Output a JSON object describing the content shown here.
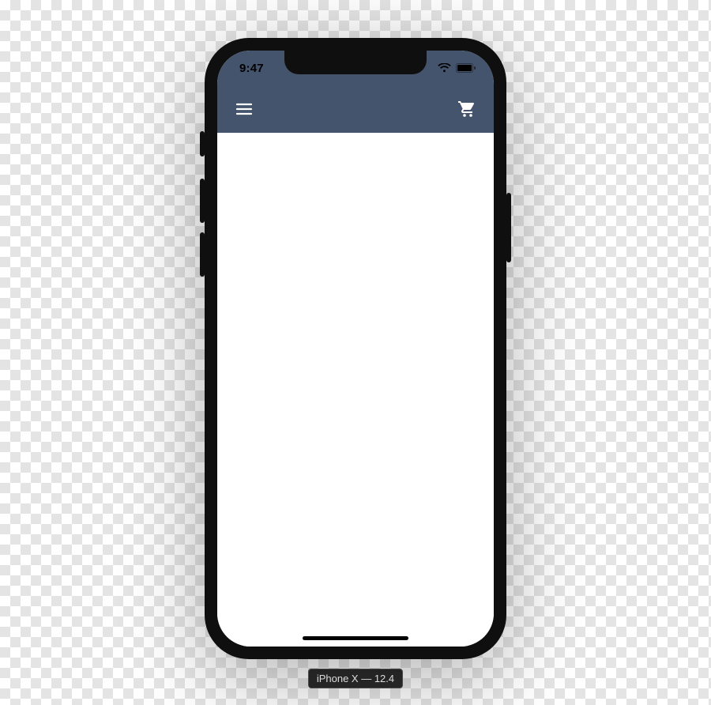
{
  "statusbar": {
    "time": "9:47"
  },
  "appbar": {
    "bg_color": "#44546c",
    "menu_icon": "menu-icon",
    "cart_icon": "cart-icon"
  },
  "simulator": {
    "caption": "iPhone X — 12.4"
  }
}
